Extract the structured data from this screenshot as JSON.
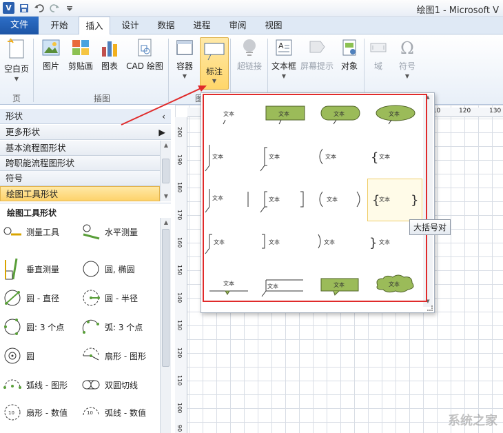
{
  "window": {
    "title": "绘图1 - Microsoft V",
    "app_icon": "V"
  },
  "tabs": {
    "file": "文件",
    "items": [
      "开始",
      "插入",
      "设计",
      "数据",
      "进程",
      "审阅",
      "视图"
    ],
    "active": "插入"
  },
  "ribbon": {
    "blank_page": "空白页",
    "group_page": "页",
    "picture": "图片",
    "clipart": "剪贴画",
    "chart": "图表",
    "cad": "CAD 绘图",
    "group_illustrations": "插图",
    "container": "容器",
    "callout": "标注",
    "group_diagram_parts": "图部",
    "hyperlink": "超链接",
    "textbox": "文本框",
    "screentip": "屏幕提示",
    "object": "对象",
    "field": "域",
    "symbol": "符号"
  },
  "shapes_pane": {
    "header": "形状",
    "more_shapes": "更多形状",
    "stencils": [
      "基本流程图形状",
      "跨职能流程图形状",
      "符号",
      "绘图工具形状"
    ],
    "active_stencil": "绘图工具形状",
    "stencil_title": "绘图工具形状",
    "items": [
      {
        "label": "测量工具",
        "icon": "measure-tool-icon"
      },
      {
        "label": "水平测量",
        "icon": "horizontal-measure-icon"
      },
      {
        "label": "垂直测量",
        "icon": "vertical-measure-icon"
      },
      {
        "label": "圆, 椭圆",
        "icon": "circle-ellipse-icon"
      },
      {
        "label": "圆 - 直径",
        "icon": "circle-diameter-icon"
      },
      {
        "label": "圆 - 半径",
        "icon": "circle-radius-icon"
      },
      {
        "label": "圆: 3 个点",
        "icon": "circle-3pt-icon"
      },
      {
        "label": "弧: 3 个点",
        "icon": "arc-3pt-icon"
      },
      {
        "label": "圆",
        "icon": "circle-icon"
      },
      {
        "label": "扇形 - 图形",
        "icon": "sector-shape-icon"
      },
      {
        "label": "弧线 - 图形",
        "icon": "arc-shape-icon"
      },
      {
        "label": "双圆切线",
        "icon": "double-circle-tangent-icon"
      },
      {
        "label": "扇形 - 数值",
        "icon": "sector-value-icon"
      },
      {
        "label": "弧线 - 数值",
        "icon": "arc-value-icon"
      }
    ]
  },
  "ruler": {
    "top_ticks": [
      "110",
      "120",
      "130"
    ],
    "left_ticks": [
      "200",
      "190",
      "180",
      "170",
      "160",
      "150",
      "140",
      "130",
      "120",
      "110",
      "100",
      "90"
    ]
  },
  "gallery": {
    "callout_text": "文本",
    "tooltip": "大括号对",
    "fill_color": "#9bbb59",
    "stroke_color": "#4f6228",
    "highlight_color": "#f0cd6a",
    "frame_color": "#e02a2a"
  },
  "watermark": "系统之家"
}
